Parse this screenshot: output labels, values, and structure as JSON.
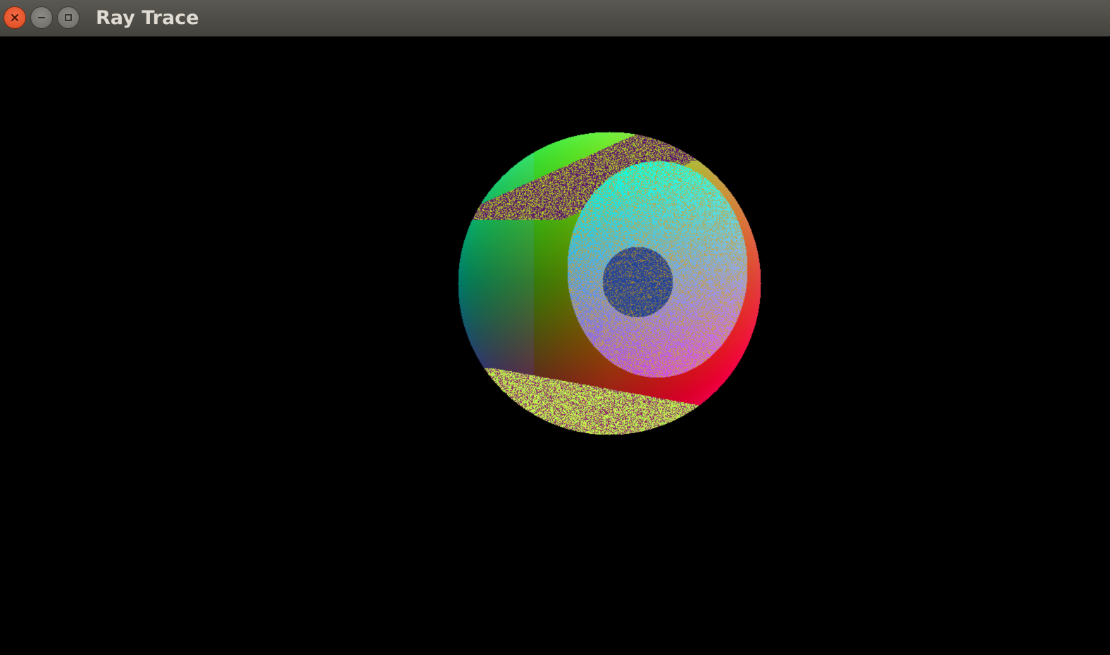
{
  "window": {
    "title": "Ray Trace"
  },
  "titlebar_buttons": {
    "close_icon": "close-icon",
    "minimize_icon": "minimize-icon",
    "maximize_icon": "maximize-icon"
  },
  "colors": {
    "titlebar": "#4f4d48",
    "close_button": "#e8552b",
    "viewport_background": "#000000"
  },
  "scene": {
    "description_items": [
      "large-sphere",
      "inner-sphere",
      "small-dark-sphere"
    ]
  }
}
